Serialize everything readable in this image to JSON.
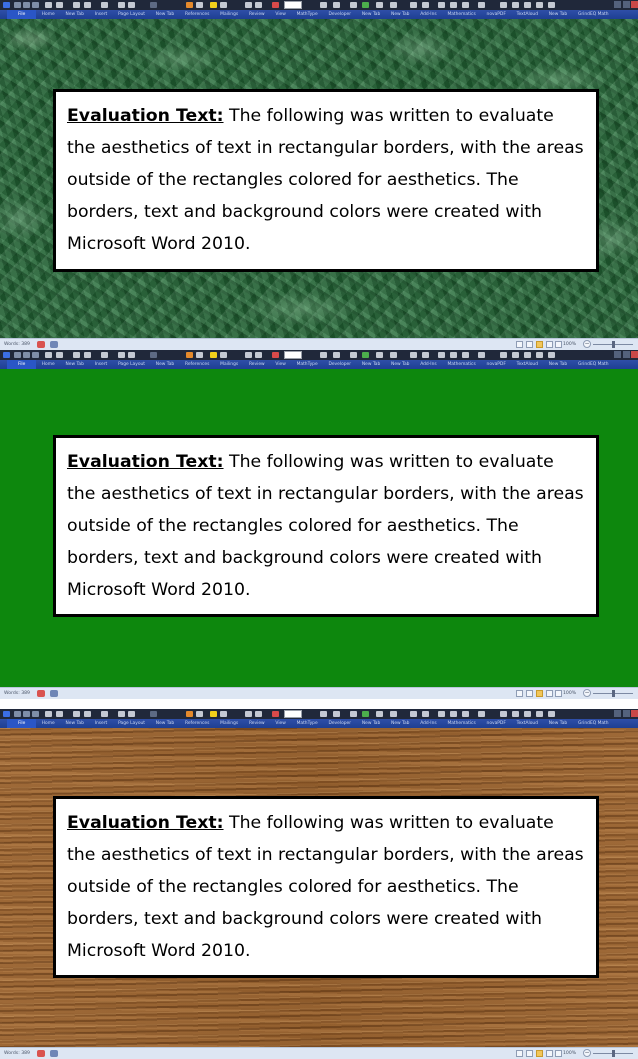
{
  "windows": [
    {
      "ribbon_tabs": [
        "File",
        "Home",
        "New Tab",
        "Insert",
        "Page Layout",
        "New Tab",
        "References",
        "Mailings",
        "Review",
        "View",
        "MathType",
        "Developer",
        "New Tab",
        "New Tab",
        "Add-Ins",
        "Mathematics",
        "novaPDF",
        "TextAloud",
        "New Tab",
        "GrindEQ Math"
      ],
      "background": "green marble texture",
      "textbox": {
        "heading": "Evaluation Text:",
        "body": " The following was written to evaluate the aesthetics of text in rectangular borders, with the areas outside of the rectangles colored for aesthetics.  The borders, text and background colors were created with Microsoft Word 2010."
      },
      "status": {
        "words": "Words: 389",
        "zoom": "100%"
      }
    },
    {
      "ribbon_tabs": [
        "File",
        "Home",
        "New Tab",
        "Insert",
        "Page Layout",
        "New Tab",
        "References",
        "Mailings",
        "Review",
        "View",
        "MathType",
        "Developer",
        "New Tab",
        "New Tab",
        "Add-Ins",
        "Mathematics",
        "novaPDF",
        "TextAloud",
        "New Tab",
        "GrindEQ Math"
      ],
      "background": "solid green",
      "textbox": {
        "heading": "Evaluation Text:",
        "body": " The following was written to evaluate the aesthetics of text in rectangular borders, with the areas outside of the rectangles colored for aesthetics.  The borders, text and background colors were created with Microsoft Word 2010."
      },
      "status": {
        "words": "Words: 389",
        "zoom": "100%"
      }
    },
    {
      "ribbon_tabs": [
        "File",
        "Home",
        "New Tab",
        "Insert",
        "Page Layout",
        "New Tab",
        "References",
        "Mailings",
        "Review",
        "View",
        "MathType",
        "Developer",
        "New Tab",
        "New Tab",
        "Add-Ins",
        "Mathematics",
        "novaPDF",
        "TextAloud",
        "New Tab",
        "GrindEQ Math"
      ],
      "background": "wood grain texture",
      "textbox": {
        "heading": "Evaluation Text:",
        "body": " The following was written to evaluate the aesthetics of text in rectangular borders, with the areas outside of the rectangles colored for aesthetics.  The borders, text and background colors were created with Microsoft Word 2010."
      },
      "status": {
        "words": "Words: 389",
        "zoom": "100%"
      }
    }
  ],
  "colors": {
    "title_bar": "#20283a",
    "ribbon": "#1e3f92",
    "solid_green": "#0d870d",
    "textbox_border": "#000000",
    "statusbar": "#dde6f3"
  },
  "icons": [
    "word-app-icon",
    "save-icon",
    "undo-icon",
    "redo-icon",
    "highlight-icon",
    "font-color-icon",
    "zoom-minus-icon"
  ]
}
